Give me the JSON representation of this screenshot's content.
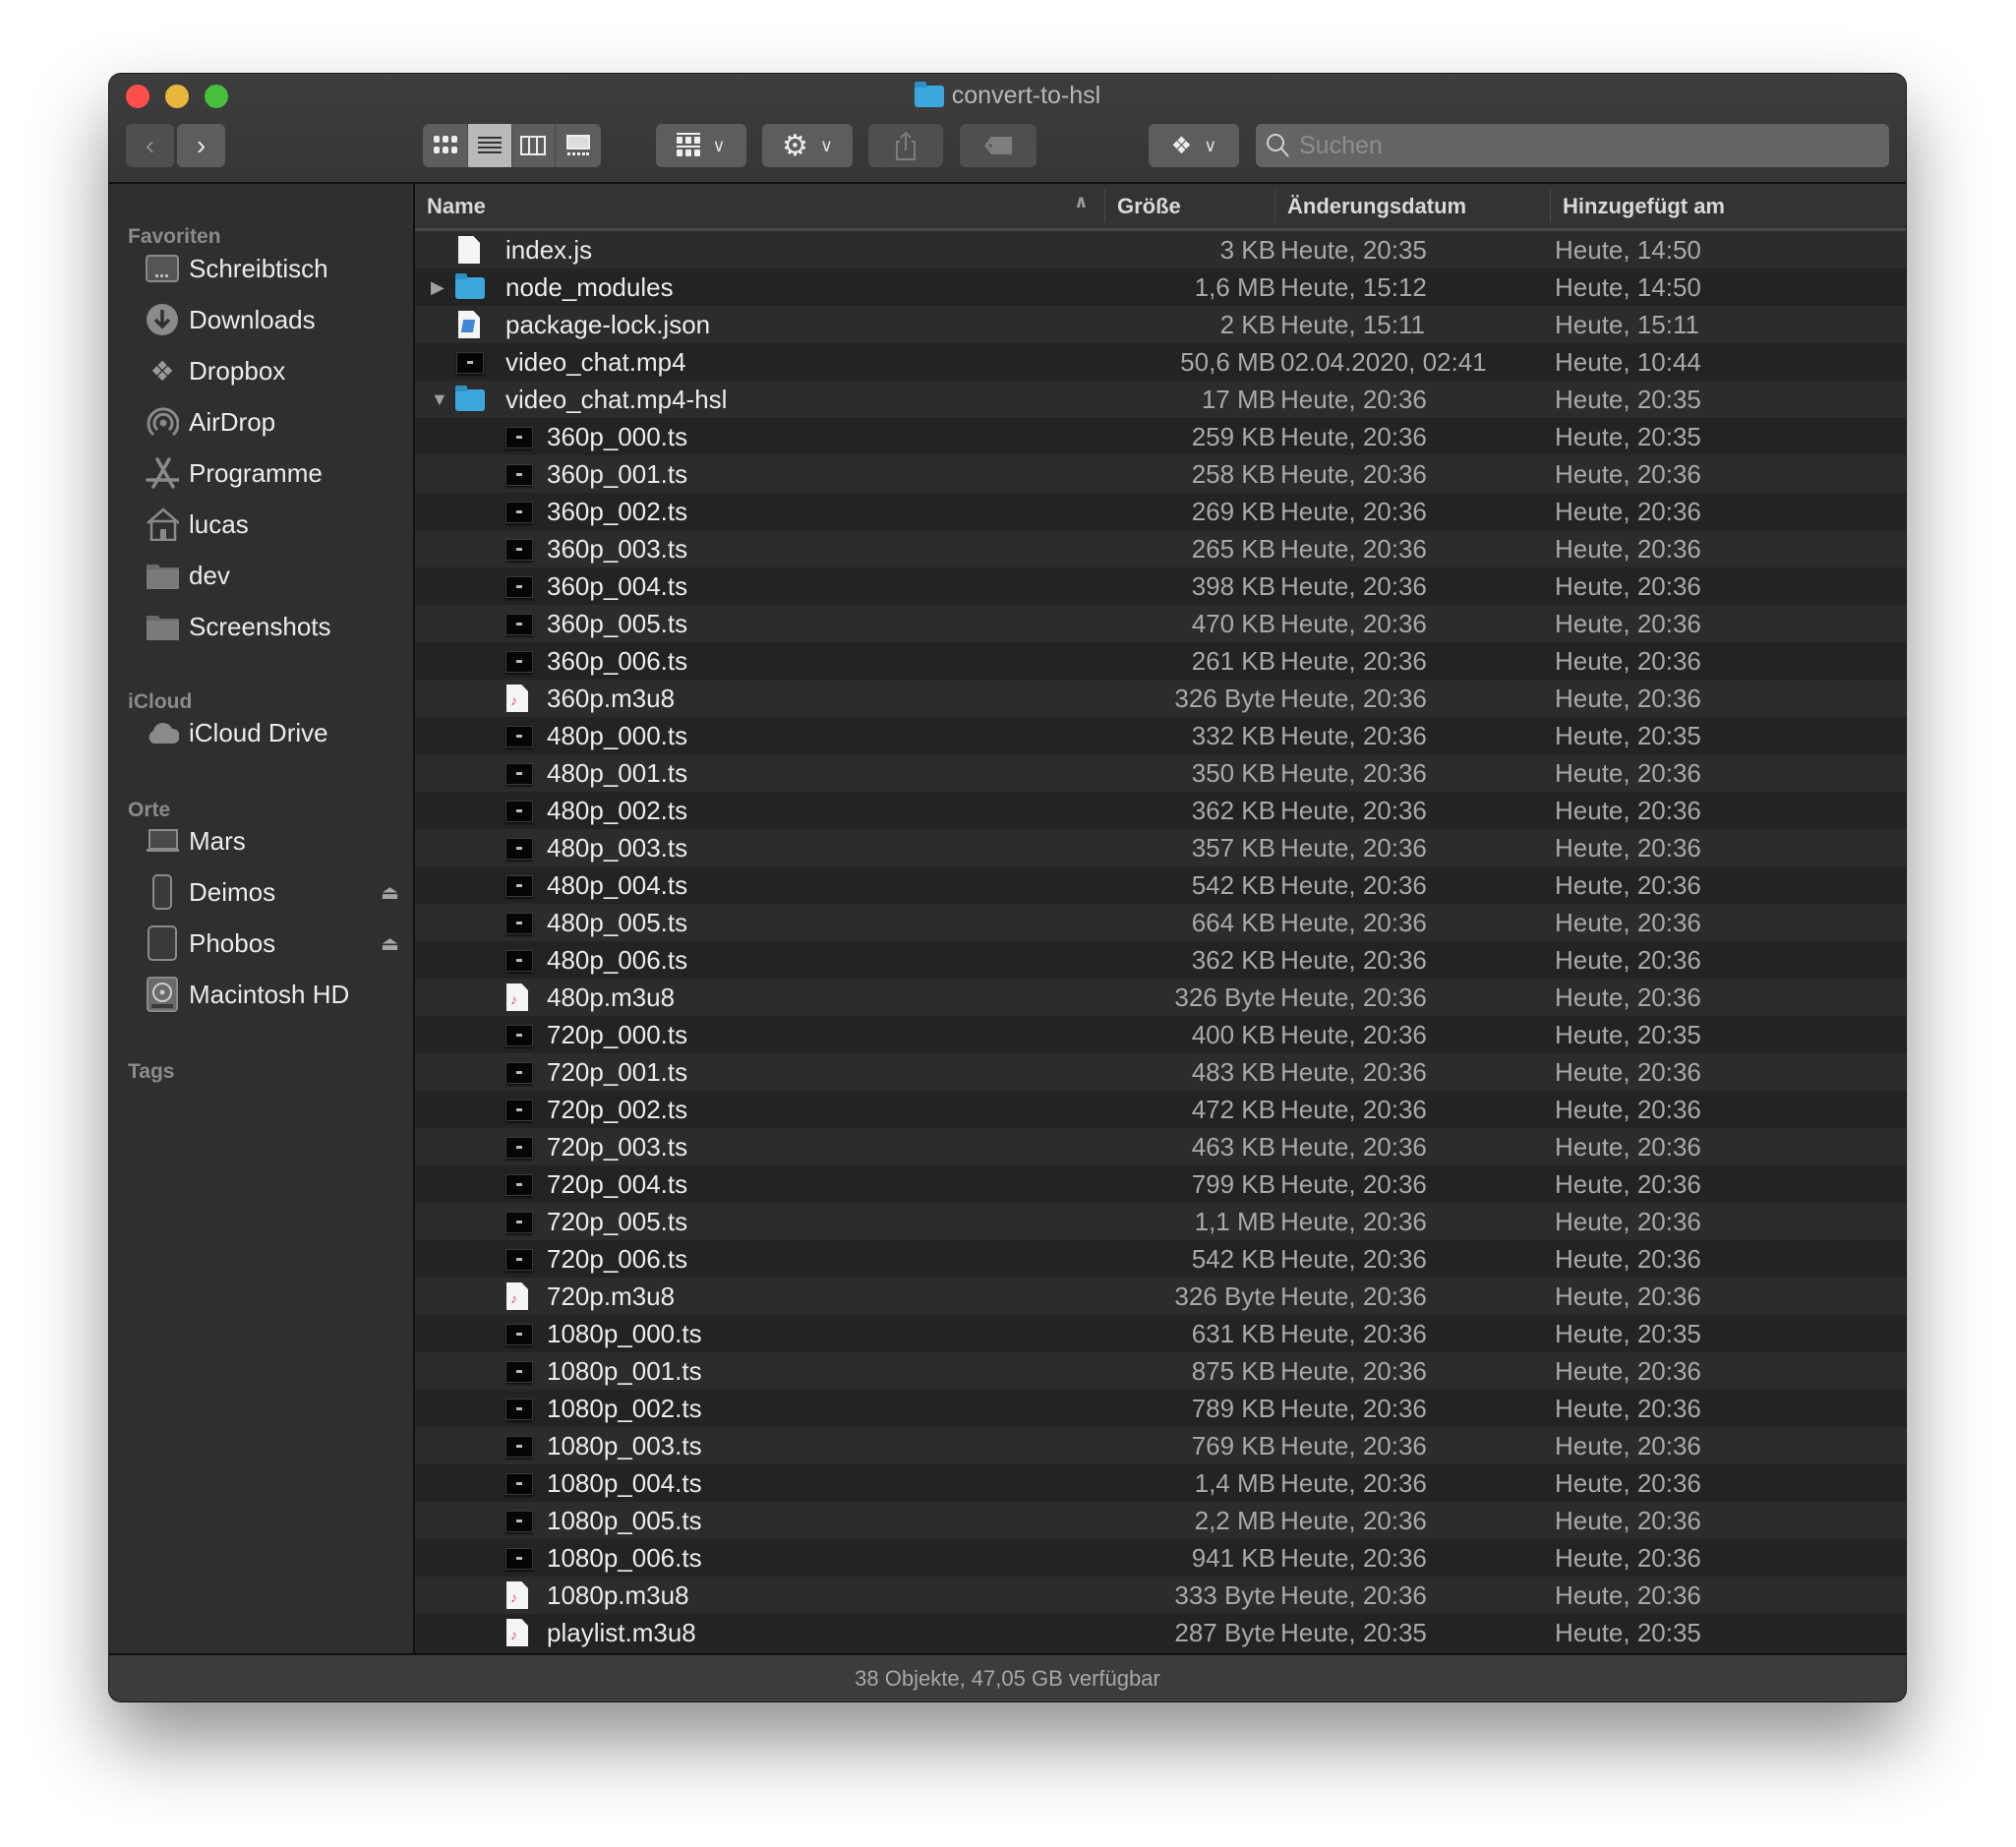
{
  "window": {
    "title": "convert-to-hsl",
    "status_text": "38 Objekte, 47,05 GB verfügbar"
  },
  "toolbar": {
    "back_icon": "chevron-left-icon",
    "forward_icon": "chevron-right-icon",
    "view_modes": [
      "icon-view",
      "list-view",
      "column-view",
      "gallery-view"
    ],
    "active_view": "list-view",
    "group_icon": "group-by-icon",
    "action_icon": "gear-icon",
    "share_icon": "share-icon",
    "tag_icon": "tag-icon",
    "dropbox_icon": "dropbox-icon",
    "search_placeholder": "Suchen"
  },
  "sidebar": {
    "sections": [
      {
        "title": "Favoriten",
        "items": [
          {
            "label": "Schreibtisch",
            "icon": "desktop-icon"
          },
          {
            "label": "Downloads",
            "icon": "download-icon"
          },
          {
            "label": "Dropbox",
            "icon": "dropbox-icon"
          },
          {
            "label": "AirDrop",
            "icon": "airdrop-icon"
          },
          {
            "label": "Programme",
            "icon": "applications-icon"
          },
          {
            "label": "lucas",
            "icon": "home-icon"
          },
          {
            "label": "dev",
            "icon": "folder-icon"
          },
          {
            "label": "Screenshots",
            "icon": "folder-icon"
          }
        ]
      },
      {
        "title": "iCloud",
        "items": [
          {
            "label": "iCloud Drive",
            "icon": "cloud-icon"
          }
        ]
      },
      {
        "title": "Orte",
        "items": [
          {
            "label": "Mars",
            "icon": "laptop-icon"
          },
          {
            "label": "Deimos",
            "icon": "phone-icon",
            "eject": true
          },
          {
            "label": "Phobos",
            "icon": "tablet-icon",
            "eject": true
          },
          {
            "label": "Macintosh HD",
            "icon": "harddisk-icon"
          }
        ]
      },
      {
        "title": "Tags",
        "items": []
      }
    ]
  },
  "columns": {
    "name": "Name",
    "size": "Größe",
    "modified": "Änderungsdatum",
    "added": "Hinzugefügt am",
    "sort_indicator": "^"
  },
  "files": [
    {
      "name": "index.js",
      "type": "doc",
      "level": 0,
      "size": "3 KB",
      "modified": "Heute, 20:35",
      "added": "Heute, 14:50"
    },
    {
      "name": "node_modules",
      "type": "folder",
      "level": 0,
      "disclosure": "collapsed",
      "size": "1,6 MB",
      "modified": "Heute, 15:12",
      "added": "Heute, 14:50"
    },
    {
      "name": "package-lock.json",
      "type": "json",
      "level": 0,
      "size": "2 KB",
      "modified": "Heute, 15:11",
      "added": "Heute, 15:11"
    },
    {
      "name": "video_chat.mp4",
      "type": "video",
      "level": 0,
      "size": "50,6 MB",
      "modified": "02.04.2020, 02:41",
      "added": "Heute, 10:44"
    },
    {
      "name": "video_chat.mp4-hsl",
      "type": "folder",
      "level": 0,
      "disclosure": "expanded",
      "size": "17 MB",
      "modified": "Heute, 20:36",
      "added": "Heute, 20:35"
    },
    {
      "name": "360p_000.ts",
      "type": "video",
      "level": 1,
      "size": "259 KB",
      "modified": "Heute, 20:36",
      "added": "Heute, 20:35"
    },
    {
      "name": "360p_001.ts",
      "type": "video",
      "level": 1,
      "size": "258 KB",
      "modified": "Heute, 20:36",
      "added": "Heute, 20:36"
    },
    {
      "name": "360p_002.ts",
      "type": "video",
      "level": 1,
      "size": "269 KB",
      "modified": "Heute, 20:36",
      "added": "Heute, 20:36"
    },
    {
      "name": "360p_003.ts",
      "type": "video",
      "level": 1,
      "size": "265 KB",
      "modified": "Heute, 20:36",
      "added": "Heute, 20:36"
    },
    {
      "name": "360p_004.ts",
      "type": "video",
      "level": 1,
      "size": "398 KB",
      "modified": "Heute, 20:36",
      "added": "Heute, 20:36"
    },
    {
      "name": "360p_005.ts",
      "type": "video",
      "level": 1,
      "size": "470 KB",
      "modified": "Heute, 20:36",
      "added": "Heute, 20:36"
    },
    {
      "name": "360p_006.ts",
      "type": "video",
      "level": 1,
      "size": "261 KB",
      "modified": "Heute, 20:36",
      "added": "Heute, 20:36"
    },
    {
      "name": "360p.m3u8",
      "type": "m3u8",
      "level": 1,
      "size": "326 Byte",
      "modified": "Heute, 20:36",
      "added": "Heute, 20:36"
    },
    {
      "name": "480p_000.ts",
      "type": "video",
      "level": 1,
      "size": "332 KB",
      "modified": "Heute, 20:36",
      "added": "Heute, 20:35"
    },
    {
      "name": "480p_001.ts",
      "type": "video",
      "level": 1,
      "size": "350 KB",
      "modified": "Heute, 20:36",
      "added": "Heute, 20:36"
    },
    {
      "name": "480p_002.ts",
      "type": "video",
      "level": 1,
      "size": "362 KB",
      "modified": "Heute, 20:36",
      "added": "Heute, 20:36"
    },
    {
      "name": "480p_003.ts",
      "type": "video",
      "level": 1,
      "size": "357 KB",
      "modified": "Heute, 20:36",
      "added": "Heute, 20:36"
    },
    {
      "name": "480p_004.ts",
      "type": "video",
      "level": 1,
      "size": "542 KB",
      "modified": "Heute, 20:36",
      "added": "Heute, 20:36"
    },
    {
      "name": "480p_005.ts",
      "type": "video",
      "level": 1,
      "size": "664 KB",
      "modified": "Heute, 20:36",
      "added": "Heute, 20:36"
    },
    {
      "name": "480p_006.ts",
      "type": "video",
      "level": 1,
      "size": "362 KB",
      "modified": "Heute, 20:36",
      "added": "Heute, 20:36"
    },
    {
      "name": "480p.m3u8",
      "type": "m3u8",
      "level": 1,
      "size": "326 Byte",
      "modified": "Heute, 20:36",
      "added": "Heute, 20:36"
    },
    {
      "name": "720p_000.ts",
      "type": "video",
      "level": 1,
      "size": "400 KB",
      "modified": "Heute, 20:36",
      "added": "Heute, 20:35"
    },
    {
      "name": "720p_001.ts",
      "type": "video",
      "level": 1,
      "size": "483 KB",
      "modified": "Heute, 20:36",
      "added": "Heute, 20:36"
    },
    {
      "name": "720p_002.ts",
      "type": "video",
      "level": 1,
      "size": "472 KB",
      "modified": "Heute, 20:36",
      "added": "Heute, 20:36"
    },
    {
      "name": "720p_003.ts",
      "type": "video",
      "level": 1,
      "size": "463 KB",
      "modified": "Heute, 20:36",
      "added": "Heute, 20:36"
    },
    {
      "name": "720p_004.ts",
      "type": "video",
      "level": 1,
      "size": "799 KB",
      "modified": "Heute, 20:36",
      "added": "Heute, 20:36"
    },
    {
      "name": "720p_005.ts",
      "type": "video",
      "level": 1,
      "size": "1,1 MB",
      "modified": "Heute, 20:36",
      "added": "Heute, 20:36"
    },
    {
      "name": "720p_006.ts",
      "type": "video",
      "level": 1,
      "size": "542 KB",
      "modified": "Heute, 20:36",
      "added": "Heute, 20:36"
    },
    {
      "name": "720p.m3u8",
      "type": "m3u8",
      "level": 1,
      "size": "326 Byte",
      "modified": "Heute, 20:36",
      "added": "Heute, 20:36"
    },
    {
      "name": "1080p_000.ts",
      "type": "video",
      "level": 1,
      "size": "631 KB",
      "modified": "Heute, 20:36",
      "added": "Heute, 20:35"
    },
    {
      "name": "1080p_001.ts",
      "type": "video",
      "level": 1,
      "size": "875 KB",
      "modified": "Heute, 20:36",
      "added": "Heute, 20:36"
    },
    {
      "name": "1080p_002.ts",
      "type": "video",
      "level": 1,
      "size": "789 KB",
      "modified": "Heute, 20:36",
      "added": "Heute, 20:36"
    },
    {
      "name": "1080p_003.ts",
      "type": "video",
      "level": 1,
      "size": "769 KB",
      "modified": "Heute, 20:36",
      "added": "Heute, 20:36"
    },
    {
      "name": "1080p_004.ts",
      "type": "video",
      "level": 1,
      "size": "1,4 MB",
      "modified": "Heute, 20:36",
      "added": "Heute, 20:36"
    },
    {
      "name": "1080p_005.ts",
      "type": "video",
      "level": 1,
      "size": "2,2 MB",
      "modified": "Heute, 20:36",
      "added": "Heute, 20:36"
    },
    {
      "name": "1080p_006.ts",
      "type": "video",
      "level": 1,
      "size": "941 KB",
      "modified": "Heute, 20:36",
      "added": "Heute, 20:36"
    },
    {
      "name": "1080p.m3u8",
      "type": "m3u8",
      "level": 1,
      "size": "333 Byte",
      "modified": "Heute, 20:36",
      "added": "Heute, 20:36"
    },
    {
      "name": "playlist.m3u8",
      "type": "m3u8",
      "level": 1,
      "size": "287 Byte",
      "modified": "Heute, 20:35",
      "added": "Heute, 20:35"
    }
  ],
  "colors": {
    "window_bg": "#2b2b2b",
    "folder_blue": "#3ba8dd",
    "close": "#fc4f4a",
    "minimize": "#e8b73c",
    "maximize": "#47bf3e"
  }
}
